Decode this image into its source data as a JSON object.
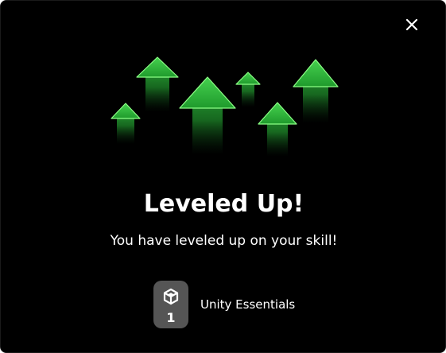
{
  "modal": {
    "close_icon": "close-icon",
    "illustration": "green-up-arrows",
    "title": "Leveled Up!",
    "subtitle": "You have leveled up on your skill!",
    "skill": {
      "icon": "unity-logo-icon",
      "level": "1",
      "name": "Unity Essentials"
    }
  },
  "colors": {
    "background": "#000000",
    "arrow_green": "#2db83d",
    "arrow_highlight": "#7dff7a",
    "badge": "#555555",
    "text": "#ffffff"
  }
}
